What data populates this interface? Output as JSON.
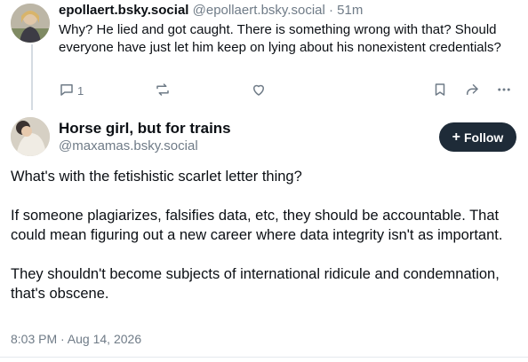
{
  "parent_post": {
    "display_name": "epollaert.bsky.social",
    "handle": "@epollaert.bsky.social",
    "separator": "·",
    "time_ago": "51m",
    "text": "Why? He lied and got caught. There is something wrong with that? Should everyone have just let him keep on lying about his nonexistent credentials?",
    "actions": {
      "reply_count": "1",
      "reply_icon": "comment-icon",
      "repost_icon": "repost-icon",
      "like_icon": "heart-icon",
      "bookmark_icon": "bookmark-icon",
      "share_icon": "share-icon",
      "more_icon": "more-icon"
    }
  },
  "main_post": {
    "display_name": "Horse girl, but for trains",
    "handle": "@maxamas.bsky.social",
    "follow_label": "Follow",
    "follow_icon": "plus-icon",
    "paragraphs": [
      "What's with the fetishistic scarlet letter thing?",
      "If someone plagiarizes, falsifies data, etc, they should be accountable. That could mean figuring out a new career where data integrity isn't as important.",
      "They shouldn't become subjects of international ridicule and condemnation, that's obscene."
    ],
    "timestamp": "8:03 PM · Aug 14, 2026"
  },
  "colors": {
    "text": "#0b0f14",
    "muted": "#6f7b87",
    "follow_bg": "#1e2b38",
    "thread_line": "#d4dbe2"
  }
}
